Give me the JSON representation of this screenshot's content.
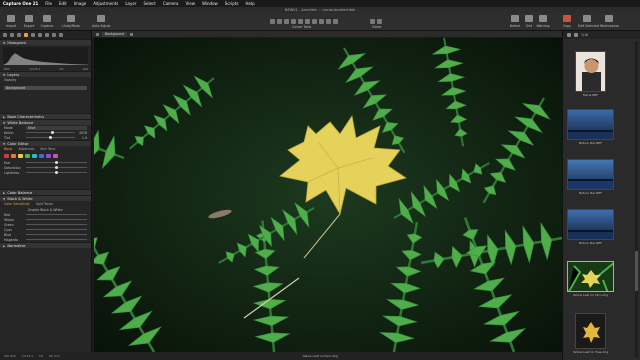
{
  "menubar": {
    "app": "Capture One 21",
    "items": [
      "File",
      "Edit",
      "Image",
      "Adjustments",
      "Layer",
      "Select",
      "Camera",
      "View",
      "Window",
      "Scripts",
      "Help"
    ]
  },
  "window": {
    "title": "NEW01 - Annelies ... ceciociocollectible"
  },
  "toolbar": {
    "left": [
      "Import",
      "Export",
      "Capture",
      "Undo/Redo",
      "Auto Adjust"
    ],
    "center_label": "Cursor Tools",
    "right_label": "Views",
    "far_right": [
      "Before",
      "Grid",
      "Exposure",
      "Warning",
      "Copy",
      "Edit Selected",
      "Workspaces"
    ]
  },
  "left_panel": {
    "histogram": {
      "title": "Histogram",
      "info": [
        "-800",
        "1/125 s",
        "f/4",
        "ISO"
      ]
    },
    "layers": {
      "title": "Layers",
      "opacity_label": "Opacity",
      "layer_name": "Background"
    },
    "base_characteristics": {
      "title": "Base Characteristics"
    },
    "white_balance": {
      "title": "White Balance",
      "mode_label": "Mode",
      "mode_value": "Shot",
      "kelvin_label": "Kelvin",
      "kelvin_value": 4978,
      "kelvin_pos": 0.55,
      "tint_label": "Tint",
      "tint_value": 1.9,
      "tint_pos": 0.5
    },
    "color_editor": {
      "title": "Color Editor",
      "tabs": [
        "Basic",
        "Advanced",
        "Skin Tone"
      ],
      "hue_label": "Hue",
      "hue_pos": 0.5,
      "saturation_label": "Saturation",
      "saturation_pos": 0.5,
      "lightness_label": "Lightness",
      "lightness_pos": 0.5,
      "swatches": [
        "#d23b3b",
        "#e27d2c",
        "#e6d23a",
        "#4fb84c",
        "#2fb6c8",
        "#3b6fd6",
        "#8a4fd2",
        "#d24fb3"
      ]
    },
    "color_balance": {
      "title": "Color Balance"
    },
    "black_white": {
      "title": "Black & White",
      "tabs": [
        "Color Sensitivity",
        "Split Tones"
      ],
      "enable_label": "Enable Black & White",
      "sliders": [
        "Red",
        "Yellow",
        "Green",
        "Cyan",
        "Blue",
        "Magenta"
      ]
    },
    "normalize": {
      "title": "Normalize"
    }
  },
  "viewer": {
    "layer_chip": "Background"
  },
  "browser": {
    "header_label": "1/16",
    "thumbs": [
      {
        "caption": "Maria.NEF",
        "kind": "portrait"
      },
      {
        "caption": "Before Pier.NEF",
        "kind": "pier1"
      },
      {
        "caption": "Before Pier.NEF",
        "kind": "pier2"
      },
      {
        "caption": "Before Pier.NEF",
        "kind": "pier3"
      },
      {
        "caption": "Yellow Leaf on Fern.dng",
        "kind": "leaf",
        "selected": true
      },
      {
        "caption": "Yellow Leaf on Tree.dng",
        "kind": "leafdark"
      }
    ]
  },
  "status": {
    "iso": "ISO 800",
    "shutter": "1/125 s",
    "aperture": "f/4",
    "focal": "60 mm",
    "filename": "Yellow Leaf on Fern.dng"
  },
  "colors": {
    "accent": "#e8a23a",
    "panel": "#262626",
    "leaf": "#e4d25a",
    "fern": "#4fae4a"
  }
}
